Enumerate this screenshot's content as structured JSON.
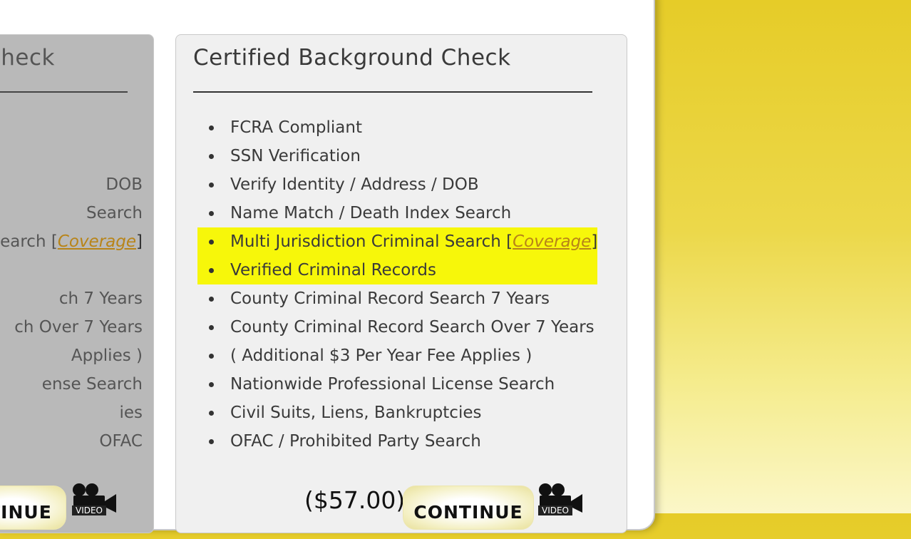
{
  "left_panel": {
    "title": "Check",
    "items": [
      "",
      "",
      "DOB",
      "Search",
      "Search [",
      "",
      "ch 7 Years",
      "ch Over 7 Years",
      " Applies )",
      "ense Search",
      "ies",
      "OFAC"
    ],
    "coverage_link": "Coverage",
    "coverage_close": "]",
    "continue_label": "NTINUE",
    "video_label": "VIDEO"
  },
  "right_panel": {
    "title": "Certified Background Check",
    "items": [
      {
        "text": "FCRA Compliant",
        "highlight": false
      },
      {
        "text": "SSN Verification",
        "highlight": false
      },
      {
        "text": "Verify Identity / Address / DOB",
        "highlight": false
      },
      {
        "text": "Name Match / Death Index Search",
        "highlight": false
      },
      {
        "text": "Multi Jurisdiction Criminal Search [",
        "highlight": true
      },
      {
        "text": "Verified Criminal Records",
        "highlight": true
      },
      {
        "text": "County Criminal Record Search 7 Years",
        "highlight": false
      },
      {
        "text": "County Criminal Record Search Over 7 Years",
        "highlight": false
      },
      {
        "text": "( Additional $3 Per Year Fee Applies )",
        "highlight": false
      },
      {
        "text": "Nationwide Professional License Search",
        "highlight": false
      },
      {
        "text": "Civil Suits, Liens, Bankruptcies",
        "highlight": false
      },
      {
        "text": "OFAC / Prohibited Party Search",
        "highlight": false
      }
    ],
    "coverage_link": "Coverage",
    "coverage_close": "]",
    "price": "($57.00)",
    "continue_label": "CONTINUE",
    "video_label": "VIDEO"
  },
  "colors": {
    "highlight": "#f7f70a",
    "coverage_link": "#b88418",
    "background_gradient_top": "#e6cc28",
    "background_gradient_bottom": "#fbf7c8"
  },
  "icons": [
    "video-camera-icon"
  ]
}
